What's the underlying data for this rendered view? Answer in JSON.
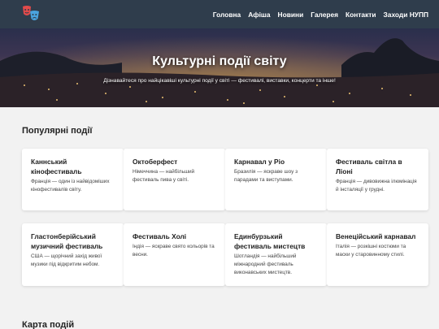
{
  "nav": {
    "items": [
      {
        "label": "Головна"
      },
      {
        "label": "Афіша"
      },
      {
        "label": "Новини"
      },
      {
        "label": "Галерея"
      },
      {
        "label": "Контакти"
      },
      {
        "label": "Заходи НУПП"
      }
    ]
  },
  "hero": {
    "title": "Культурні події світу",
    "subtitle": "Дізнавайтеся про найцікавіші культурні події у світі — фестивалі, виставки, концерти та інше!"
  },
  "popular": {
    "title": "Популярні події",
    "cards": [
      {
        "title": "Каннський кінофестиваль",
        "desc": "Франція — один із найвідоміших кінофестивалів світу."
      },
      {
        "title": "Октоберфест",
        "desc": "Німеччина — найбільший фестиваль пива у світі."
      },
      {
        "title": "Карнавал у Ріо",
        "desc": "Бразилія — яскраве шоу з парадами та виступами."
      },
      {
        "title": "Фестиваль світла в Ліоні",
        "desc": "Франція — дивовижна ілюмінація й інсталяції у грудні."
      },
      {
        "title": "Гластонберійський музичний фестиваль",
        "desc": "США — щорічний захід живої музики під відкритим небом."
      },
      {
        "title": "Фестиваль Холі",
        "desc": "Індія — яскраве свято кольорів та весни."
      },
      {
        "title": "Единбурзький фестиваль мистецтв",
        "desc": "Шотландія — найбільший міжнародний фестиваль виконавських мистецтв."
      },
      {
        "title": "Венеційський карнавал",
        "desc": "Італія — розкішні костюми та маски у старовинному стилі."
      }
    ]
  },
  "map_section": {
    "title": "Карта подій"
  },
  "colors": {
    "navbar": "#2f3d4c",
    "background": "#f2f2f2",
    "card": "#ffffff"
  }
}
